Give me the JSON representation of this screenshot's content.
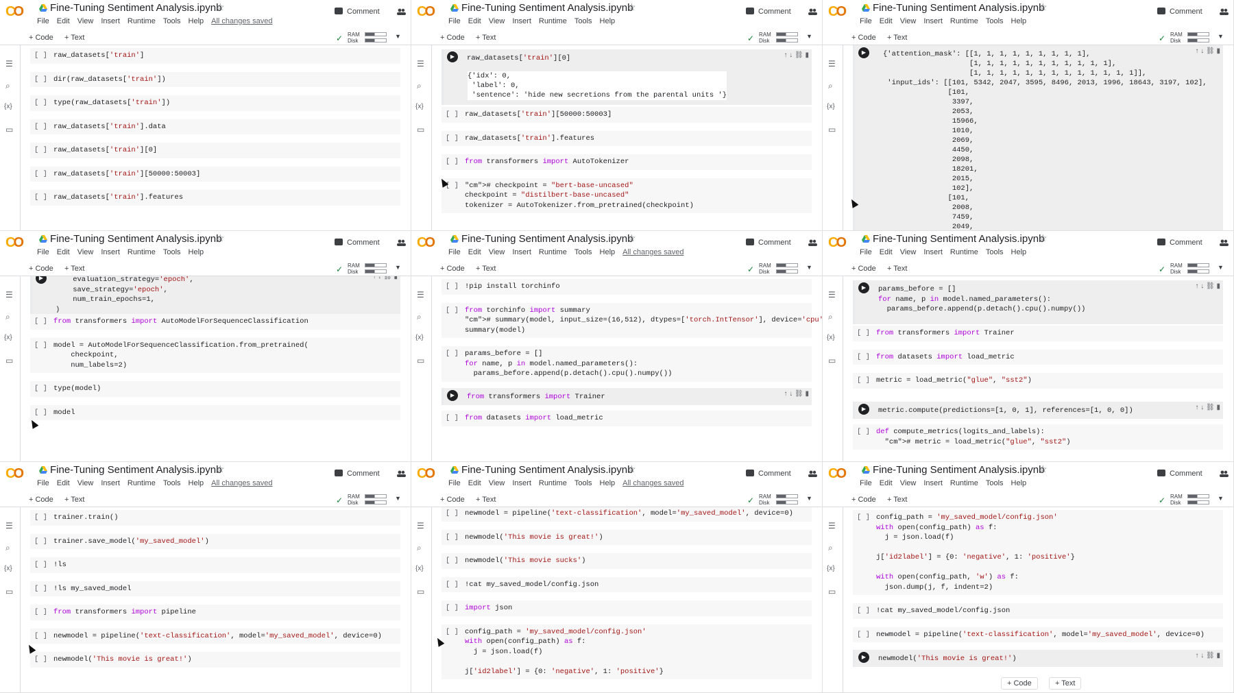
{
  "app": {
    "title": "Fine-Tuning Sentiment Analysis.ipynb",
    "menu": [
      "File",
      "Edit",
      "View",
      "Insert",
      "Runtime",
      "Tools",
      "Help"
    ],
    "saved": "All changes saved",
    "comment": "Comment",
    "add_code": "+ Code",
    "add_text": "+ Text",
    "ram": "RAM",
    "disk": "Disk"
  },
  "p1": {
    "cells": [
      "raw_datasets['train']",
      "dir(raw_datasets['train'])",
      "type(raw_datasets['train'])",
      "raw_datasets['train'].data",
      "raw_datasets['train'][0]",
      "raw_datasets['train'][50000:50003]",
      "raw_datasets['train'].features"
    ]
  },
  "p2": {
    "active": "raw_datasets['train'][0]",
    "output": "{'idx': 0,\n 'label': 0,\n 'sentence': 'hide new secretions from the parental units '}",
    "cells": [
      "raw_datasets['train'][50000:50003]",
      "raw_datasets['train'].features",
      "from transformers import AutoTokenizer",
      "# checkpoint = \"bert-base-uncased\"\ncheckpoint = \"distilbert-base-uncased\"\ntokenizer = AutoTokenizer.from_pretrained(checkpoint)"
    ]
  },
  "p3": {
    "output": "{'attention_mask': [[1, 1, 1, 1, 1, 1, 1, 1, 1],\n                    [1, 1, 1, 1, 1, 1, 1, 1, 1, 1, 1],\n                    [1, 1, 1, 1, 1, 1, 1, 1, 1, 1, 1, 1, 1]],\n 'input_ids': [[101, 5342, 2047, 3595, 8496, 2013, 1996, 18643, 3197, 102],\n               [101,\n                3397,\n                2053,\n                15966,\n                1010,\n                2069,\n                4450,\n                2098,\n                18201,\n                2015,\n                102],\n               [101,\n                2008,\n                7459,\n                2049,"
  },
  "p4": {
    "active": "    evaluation_strategy='epoch',\n    save_strategy='epoch',\n    num_train_epochs=1,\n)",
    "cells": [
      "from transformers import AutoModelForSequenceClassification",
      "model = AutoModelForSequenceClassification.from_pretrained(\n    checkpoint,\n    num_labels=2)",
      "type(model)",
      "model",
      "!pip install torchinfo"
    ]
  },
  "p5": {
    "cells": [
      "!pip install torchinfo",
      "from torchinfo import summary\n# summary(model, input_size=(16,512), dtypes=['torch.IntTensor'], device='cpu')\nsummary(model)",
      "params_before = []\nfor name, p in model.named_parameters():\n  params_before.append(p.detach().cpu().numpy())",
      "from transformers import Trainer",
      "from datasets import load_metric"
    ]
  },
  "p6": {
    "active": "params_before = []\nfor name, p in model.named_parameters():\n  params_before.append(p.detach().cpu().numpy())",
    "cells": [
      "from transformers import Trainer",
      "from datasets import load_metric",
      "metric = load_metric(\"glue\", \"sst2\")",
      "metric.compute(predictions=[1, 0, 1], references=[1, 0, 0])",
      "def compute_metrics(logits_and_labels):\n  # metric = load_metric(\"glue\", \"sst2\")"
    ]
  },
  "p7": {
    "cells": [
      "trainer.train()",
      "trainer.save_model('my_saved_model')",
      "!ls",
      "!ls my_saved_model",
      "from transformers import pipeline",
      "newmodel = pipeline('text-classification', model='my_saved_model', device=0)",
      "newmodel('This movie is great!')"
    ]
  },
  "p8": {
    "cells": [
      "newmodel = pipeline('text-classification', model='my_saved_model', device=0)",
      "newmodel('This movie is great!')",
      "newmodel('This movie sucks')",
      "!cat my_saved_model/config.json",
      "import json",
      "config_path = 'my_saved_model/config.json'\nwith open(config_path) as f:\n  j = json.load(f)\n\nj['id2label'] = {0: 'negative', 1: 'positive'}"
    ]
  },
  "p9": {
    "cells": [
      "config_path = 'my_saved_model/config.json'\nwith open(config_path) as f:\n  j = json.load(f)\n\nj['id2label'] = {0: 'negative', 1: 'positive'}\n\nwith open(config_path, 'w') as f:\n  json.dump(j, f, indent=2)",
      "!cat my_saved_model/config.json",
      "newmodel = pipeline('text-classification', model='my_saved_model', device=0)",
      "newmodel('This movie is great!')"
    ]
  }
}
